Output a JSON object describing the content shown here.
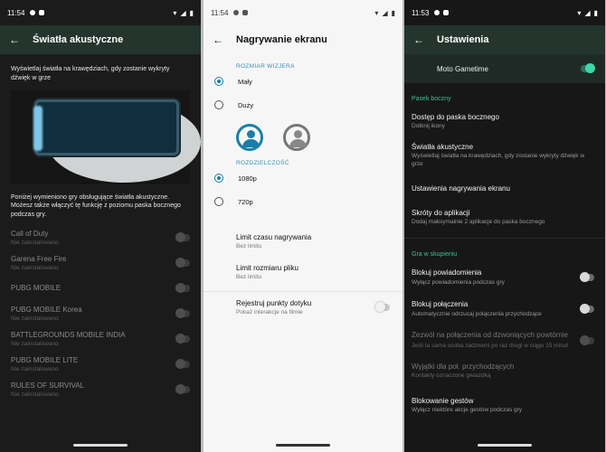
{
  "screen1": {
    "status": {
      "time": "11:54"
    },
    "title": "Światła akustyczne",
    "intro": "Wyświetlaj światła na krawędziach, gdy zostanie wykryty dźwięk w grze",
    "description": "Poniżej wymieniono gry obsługujące światła akustyczne. Możesz także włączyć tę funkcję z poziomu paska bocznego podczas gry.",
    "games": [
      {
        "name": "Call of Duty",
        "sub": "Nie zainstalowano"
      },
      {
        "name": "Garena Free Fire",
        "sub": "Nie zainstalowano"
      },
      {
        "name": "PUBG MOBILE",
        "sub": "Nie zainstalowano"
      },
      {
        "name": "PUBG MOBILE Korea",
        "sub": "Nie zainstalowano"
      },
      {
        "name": "BATTLEGROUNDS MOBILE INDIA",
        "sub": "Nie zainstalowano"
      },
      {
        "name": "PUBG MOBILE LITE",
        "sub": "Nie zainstalowano"
      },
      {
        "name": "RULES OF SURVIVAL",
        "sub": "Nie zainstalowano"
      }
    ]
  },
  "screen2": {
    "status": {
      "time": "11:54"
    },
    "title": "Nagrywanie ekranu",
    "viewfinder_label": "ROZMIAR WIZJERA",
    "size_options": [
      "Mały",
      "Duży"
    ],
    "selected_size": "Mały",
    "resolution_label": "ROZDZIELCZOŚĆ",
    "resolution_options": [
      "1080p",
      "720p"
    ],
    "selected_resolution": "1080p",
    "time_limit": {
      "name": "Limit czasu nagrywania",
      "sub": "Bez limitu"
    },
    "size_limit": {
      "name": "Limit rozmiaru pliku",
      "sub": "Bez limitu"
    },
    "touch": {
      "name": "Rejestruj punkty dotyku",
      "sub": "Pokaż interakcje na filmie",
      "on": false
    }
  },
  "screen3": {
    "status": {
      "time": "11:53"
    },
    "title": "Ustawienia",
    "gametime": {
      "label": "Moto Gametime",
      "on": true
    },
    "sidebar_section": "Pasek boczny",
    "sidebar_items": [
      {
        "name": "Dostęp do paska bocznego",
        "sub": "Dotknij ikony"
      },
      {
        "name": "Światła akustyczne",
        "sub": "Wyświetlaj światła na krawędziach, gdy zostanie wykryty dźwięk w grze"
      },
      {
        "name": "Ustawienia nagrywania ekranu",
        "sub": ""
      },
      {
        "name": "Skróty do aplikacji",
        "sub": "Dodaj maksymalnie 2 aplikacje do paska bocznego"
      }
    ],
    "focus_section": "Gra w skupieniu",
    "block_notifications": {
      "name": "Blokuj powiadomienia",
      "sub": "Wyłącz powiadomienia podczas gry",
      "on": false
    },
    "block_calls": {
      "name": "Blokuj połączenia",
      "sub": "Automatycznie odrzucaj połączenia przychodzące",
      "on": false
    },
    "allow_repeat": {
      "name": "Zezwól na połączenia od dzwoniących powtórnie",
      "sub": "Jeśli ta sama osoba zadzwoni po raz drugi w ciągu 15 minut",
      "on": false
    },
    "exceptions": {
      "name": "Wyjątki dla poł. przychodzących",
      "sub": "Kontakty oznaczone gwiazdką"
    },
    "gestures": {
      "name": "Blokowanie gestów",
      "sub": "Wyłącz niektóre akcje gestów podczas gry"
    }
  }
}
